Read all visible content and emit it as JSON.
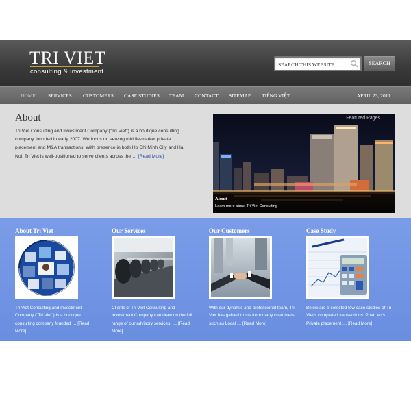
{
  "header": {
    "logo_title": "TRI VIET",
    "logo_subtitle": "consulting & investment",
    "search_placeholder": "SEARCH THIS WEBSITE...",
    "search_button": "SEARCH"
  },
  "nav": {
    "items": [
      {
        "label": "HOME"
      },
      {
        "label": "SERVICES"
      },
      {
        "label": "CUSTOMERS"
      },
      {
        "label": "CASE STUDIES"
      },
      {
        "label": "TEAM"
      },
      {
        "label": "CONTACT"
      },
      {
        "label": "SITEMAP"
      },
      {
        "label": "TIẾNG VIỆT"
      }
    ],
    "date": "APRIL 23, 2011"
  },
  "intro": {
    "title": "About",
    "text": "Tri Viet Consulting and Investment Company (\"Tri Viet\") is a boutique consulting company founded in early 2007.  We focus on serving middle-market private placement and M&A transactions.  With presence in both Ho Chi Minh City and Ha Noi, Tri Viet is well-positioned to serve clients across the …",
    "read_more": "[Read More]"
  },
  "featured": {
    "tag": "Featured Pages",
    "caption_title": "About",
    "caption_text": "Learn more about Tri Viet Consulting"
  },
  "columns": [
    {
      "title": "About Tri Viet",
      "text": "Tri Viet Consulting and Investment Company (\"Tri Viet\") is a boutique consulting company founded … [Read More]"
    },
    {
      "title": "Our Services",
      "text": "Clients of Tri Viet Consulting and Investment Company can draw on the full range of our advisory services, … [Read More]"
    },
    {
      "title": "Our Customers",
      "text": "With our dynamic and professional team, Tri Viet has gained trusts from many customers such as Local … [Read More]"
    },
    {
      "title": "Case Study",
      "text": "Below are a selected few case studies of Tri Viet's completed transactions: Phan Vu's Private placement … [Read More]"
    }
  ]
}
